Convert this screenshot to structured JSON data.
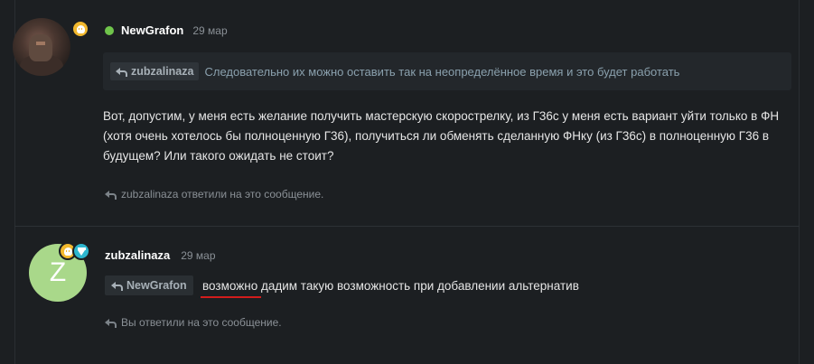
{
  "post1": {
    "username": "NewGrafon",
    "date": "29 мар",
    "quote": {
      "author": "zubzalinaza",
      "text": "Следовательно их можно оставить так на неопределённое время и это будет работать"
    },
    "body": "Вот, допустим, у меня есть желание получить мастерскую скорострелку, из Г36с у меня есть вариант уйти только в ФН (хотя очень хотелось бы полноценную Г36), получиться ли обменять сделанную ФНку (из Г36с) в полноценную Г36 в будущем? Или такого ожидать не стоит?",
    "replied_note": "zubzalinaza ответили на это сообщение."
  },
  "post2": {
    "username": "zubzalinaza",
    "date": "29 мар",
    "avatar_letter": "Z",
    "quote_author": "NewGrafon",
    "message_highlight": "возможно",
    "message_rest": " дадим такую возможность при добавлении альтернатив",
    "replied_note": "Вы ответили на это сообщение."
  },
  "icons": {
    "online": "online-status-icon",
    "gold_badge": "skull-badge-icon",
    "diamond_badge": "diamond-badge-icon",
    "reply": "reply-arrow-icon"
  },
  "colors": {
    "background": "#1c1f22",
    "online": "#6fc44b",
    "gold": "#f2b82d",
    "diamond": "#2db6cf",
    "avatar_z": "#a9d88a",
    "underline": "#d21c1c"
  }
}
